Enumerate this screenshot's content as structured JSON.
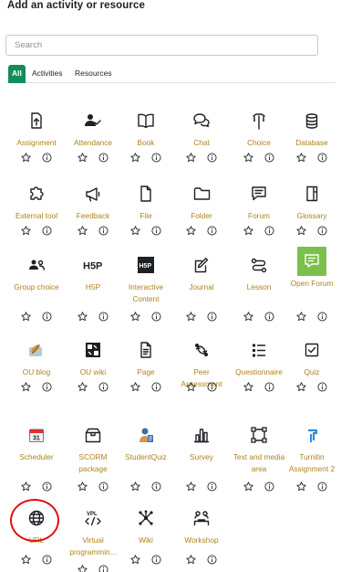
{
  "header": {
    "title": "Add an activity or resource"
  },
  "search": {
    "placeholder": "Search"
  },
  "tabs": [
    {
      "label": "All",
      "active": true
    },
    {
      "label": "Activities",
      "active": false
    },
    {
      "label": "Resources",
      "active": false
    }
  ],
  "colors": {
    "label": "#b0821b",
    "tab_active": "#128d5a",
    "open_forum_bg": "#7cc04b",
    "highlight_circle": "#dd1111"
  },
  "items": [
    {
      "label": "Assignment",
      "icon": "assignment-upload-icon"
    },
    {
      "label": "Attendance",
      "icon": "attendance-people-icon"
    },
    {
      "label": "Book",
      "icon": "book-icon"
    },
    {
      "label": "Chat",
      "icon": "chat-bubbles-icon"
    },
    {
      "label": "Choice",
      "icon": "choice-signpost-icon"
    },
    {
      "label": "Database",
      "icon": "database-icon"
    },
    {
      "label": "External tool",
      "icon": "puzzle-piece-icon"
    },
    {
      "label": "Feedback",
      "icon": "megaphone-icon"
    },
    {
      "label": "File",
      "icon": "file-icon"
    },
    {
      "label": "Folder",
      "icon": "folder-icon"
    },
    {
      "label": "Forum",
      "icon": "forum-bubble-icon"
    },
    {
      "label": "Glossary",
      "icon": "glossary-book-icon"
    },
    {
      "label": "Group choice",
      "icon": "group-people-icon"
    },
    {
      "label": "H5P",
      "icon": "h5p-logo-icon"
    },
    {
      "label": "Interactive Content",
      "icon": "h5p-dark-logo-icon"
    },
    {
      "label": "Journal",
      "icon": "journal-pencil-icon"
    },
    {
      "label": "Lesson",
      "icon": "lesson-path-icon"
    },
    {
      "label": "Open Forum",
      "icon": "open-forum-icon"
    },
    {
      "label": "OU blog",
      "icon": "ou-blog-icon"
    },
    {
      "label": "OU wiki",
      "icon": "ou-wiki-icon"
    },
    {
      "label": "Page",
      "icon": "page-icon"
    },
    {
      "label": "Peer Assessment",
      "icon": "peer-assessment-icon"
    },
    {
      "label": "Questionnaire",
      "icon": "questionnaire-list-icon"
    },
    {
      "label": "Quiz",
      "icon": "quiz-checkbox-icon"
    },
    {
      "label": "Scheduler",
      "icon": "scheduler-calendar-icon"
    },
    {
      "label": "SCORM package",
      "icon": "scorm-box-icon"
    },
    {
      "label": "StudentQuiz",
      "icon": "student-quiz-icon"
    },
    {
      "label": "Survey",
      "icon": "survey-bars-icon"
    },
    {
      "label": "Text and media area",
      "icon": "text-media-area-icon"
    },
    {
      "label": "Turnitin Assignment 2",
      "icon": "turnitin-icon"
    },
    {
      "label": "URL",
      "icon": "globe-icon"
    },
    {
      "label": "Virtual programmin...",
      "icon": "vpl-code-icon"
    },
    {
      "label": "Wiki",
      "icon": "wiki-network-icon"
    },
    {
      "label": "Workshop",
      "icon": "workshop-people-icon"
    }
  ]
}
